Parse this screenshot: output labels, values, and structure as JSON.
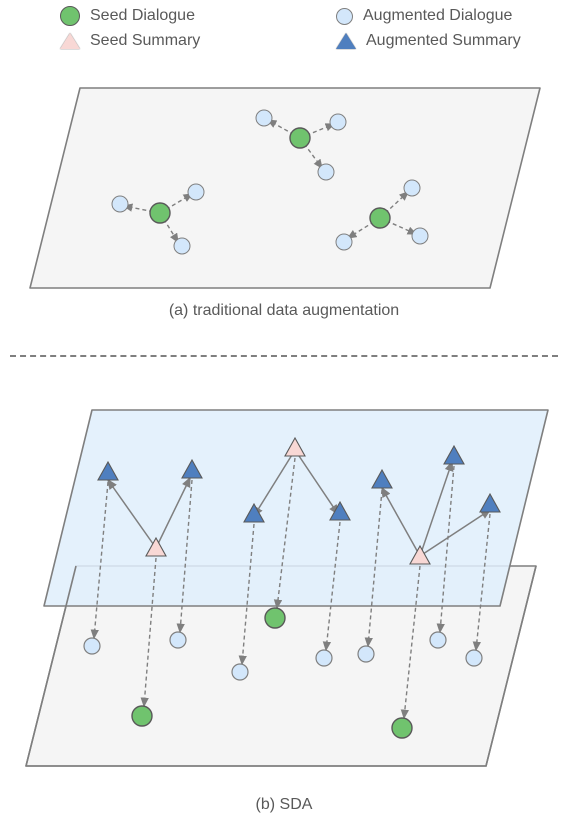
{
  "legend": {
    "seed_dialogue": "Seed Dialogue",
    "augmented_dialogue": "Augmented Dialogue",
    "seed_summary": "Seed Summary",
    "augmented_summary": "Augmented Summary"
  },
  "captions": {
    "a": "(a) traditional data augmentation",
    "b": "(b) SDA"
  },
  "colors": {
    "seed_dialogue": "#70c36e",
    "augmented_dialogue": "#d3e7fb",
    "seed_summary": "#f8d8d5",
    "augmented_summary": "#4f7fbf",
    "plane_stroke": "#7f7f7f",
    "plane_fill_a": "#f5f5f5",
    "plane_fill_b_front": "#dfeefb",
    "text": "#595959"
  },
  "chart_data": [
    {
      "type": "diagram",
      "id": "a",
      "title": "(a) traditional data augmentation",
      "description": "Single plane. Three seed-dialogue points (green circles). Each seed radiates to ~3 augmented-dialogue points (light-blue circles) nearby, connected by short dashed arrows from seed outward.",
      "seeds": [
        {
          "x": 0.53,
          "y": 0.28
        },
        {
          "x": 0.27,
          "y": 0.58
        },
        {
          "x": 0.7,
          "y": 0.62
        }
      ],
      "augmented_per_seed": 3,
      "arrow_style": "dashed"
    },
    {
      "type": "diagram",
      "id": "b",
      "title": "(b) SDA",
      "description": "Two stacked planes. Upper plane (light-blue) has 3 seed-summary triangles (pink); each spawns 2–3 augmented-summary triangles (blue) via solid arrows. Each summary triangle projects down (dashed arrow) to a dialogue circle on the lower plane (grey): pink→green seed dialogue, blue→light-blue augmented dialogue.",
      "seed_summaries": 3,
      "augmented_summaries": 7,
      "seed_dialogues": 3,
      "augmented_dialogues": 7,
      "arrows": {
        "within_plane": "solid",
        "between_planes": "dashed"
      }
    }
  ]
}
